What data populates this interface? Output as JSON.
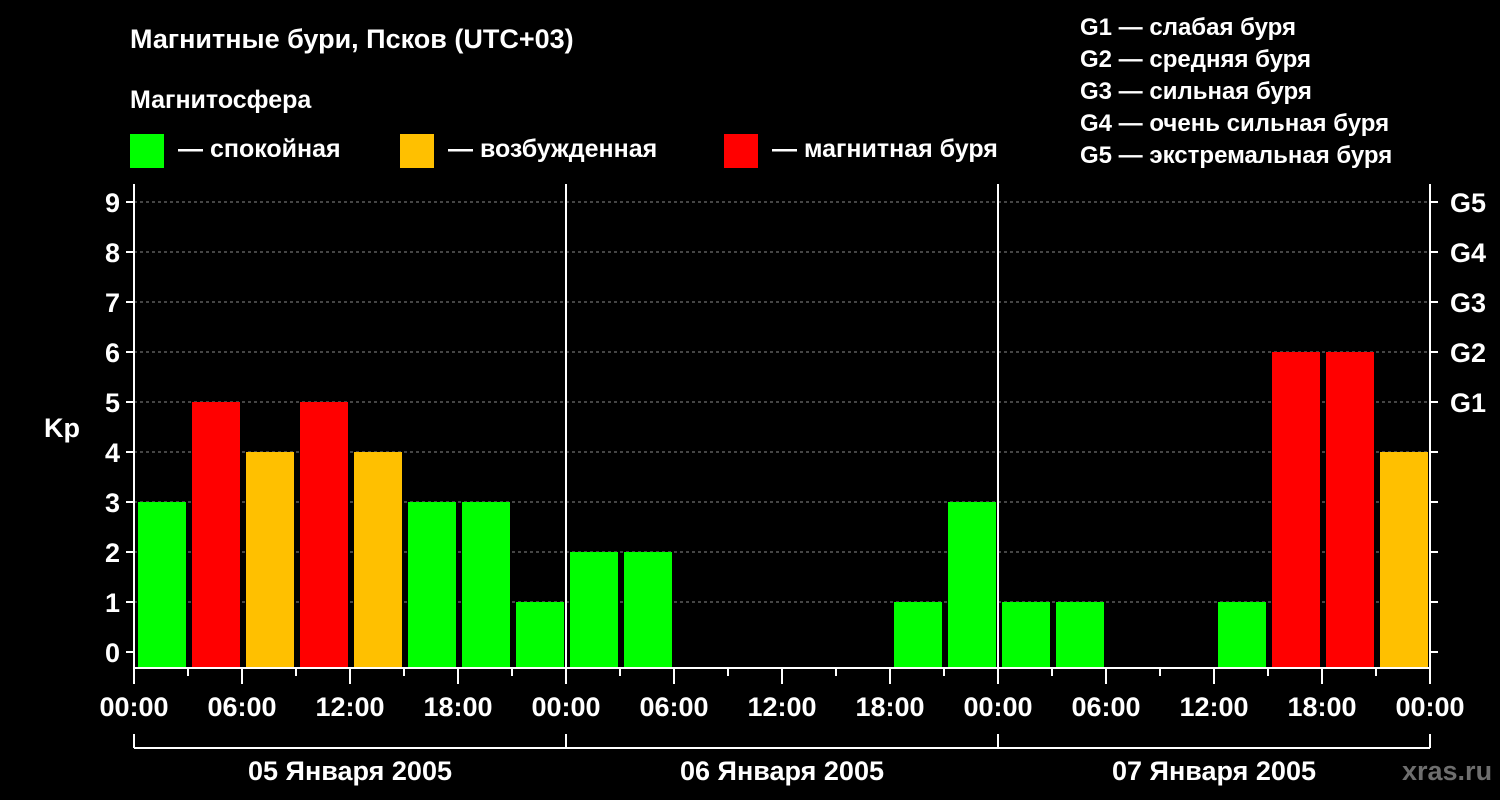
{
  "header": {
    "title": "Магнитные бури, Псков (UTC+03)",
    "section": "Магнитосфера"
  },
  "legend": [
    {
      "label": "— спокойная",
      "color": "#00ff00"
    },
    {
      "label": "— возбужденная",
      "color": "#ffc000"
    },
    {
      "label": "— магнитная буря",
      "color": "#ff0000"
    }
  ],
  "g_legend": [
    "G1 — слабая буря",
    "G2 — средняя буря",
    "G3 — сильная буря",
    "G4 — очень сильная буря",
    "G5 — экстремальная буря"
  ],
  "watermark": "xras.ru",
  "chart_data": {
    "type": "bar",
    "ylabel": "Kp",
    "ylim": [
      0,
      9
    ],
    "yticks": [
      "0",
      "1",
      "2",
      "3",
      "4",
      "5",
      "6",
      "7",
      "8",
      "9"
    ],
    "right_ticks": [
      {
        "y": 5,
        "label": "G1"
      },
      {
        "y": 6,
        "label": "G2"
      },
      {
        "y": 7,
        "label": "G3"
      },
      {
        "y": 8,
        "label": "G4"
      },
      {
        "y": 9,
        "label": "G5"
      }
    ],
    "xtick_labels": [
      "00:00",
      "06:00",
      "12:00",
      "18:00",
      "00:00",
      "06:00",
      "12:00",
      "18:00",
      "00:00",
      "06:00",
      "12:00",
      "18:00",
      "00:00"
    ],
    "days": [
      "05 Января 2005",
      "06 Января 2005",
      "07 Января 2005"
    ],
    "interval_hours": 3,
    "values": [
      3,
      5,
      4,
      5,
      4,
      3,
      3,
      1,
      2,
      2,
      0,
      0,
      0,
      0,
      1,
      3,
      1,
      1,
      0,
      0,
      1,
      6,
      6,
      4
    ],
    "colors": {
      "quiet": "#00ff00",
      "active": "#ffc000",
      "storm": "#ff0000"
    },
    "grid": true
  }
}
